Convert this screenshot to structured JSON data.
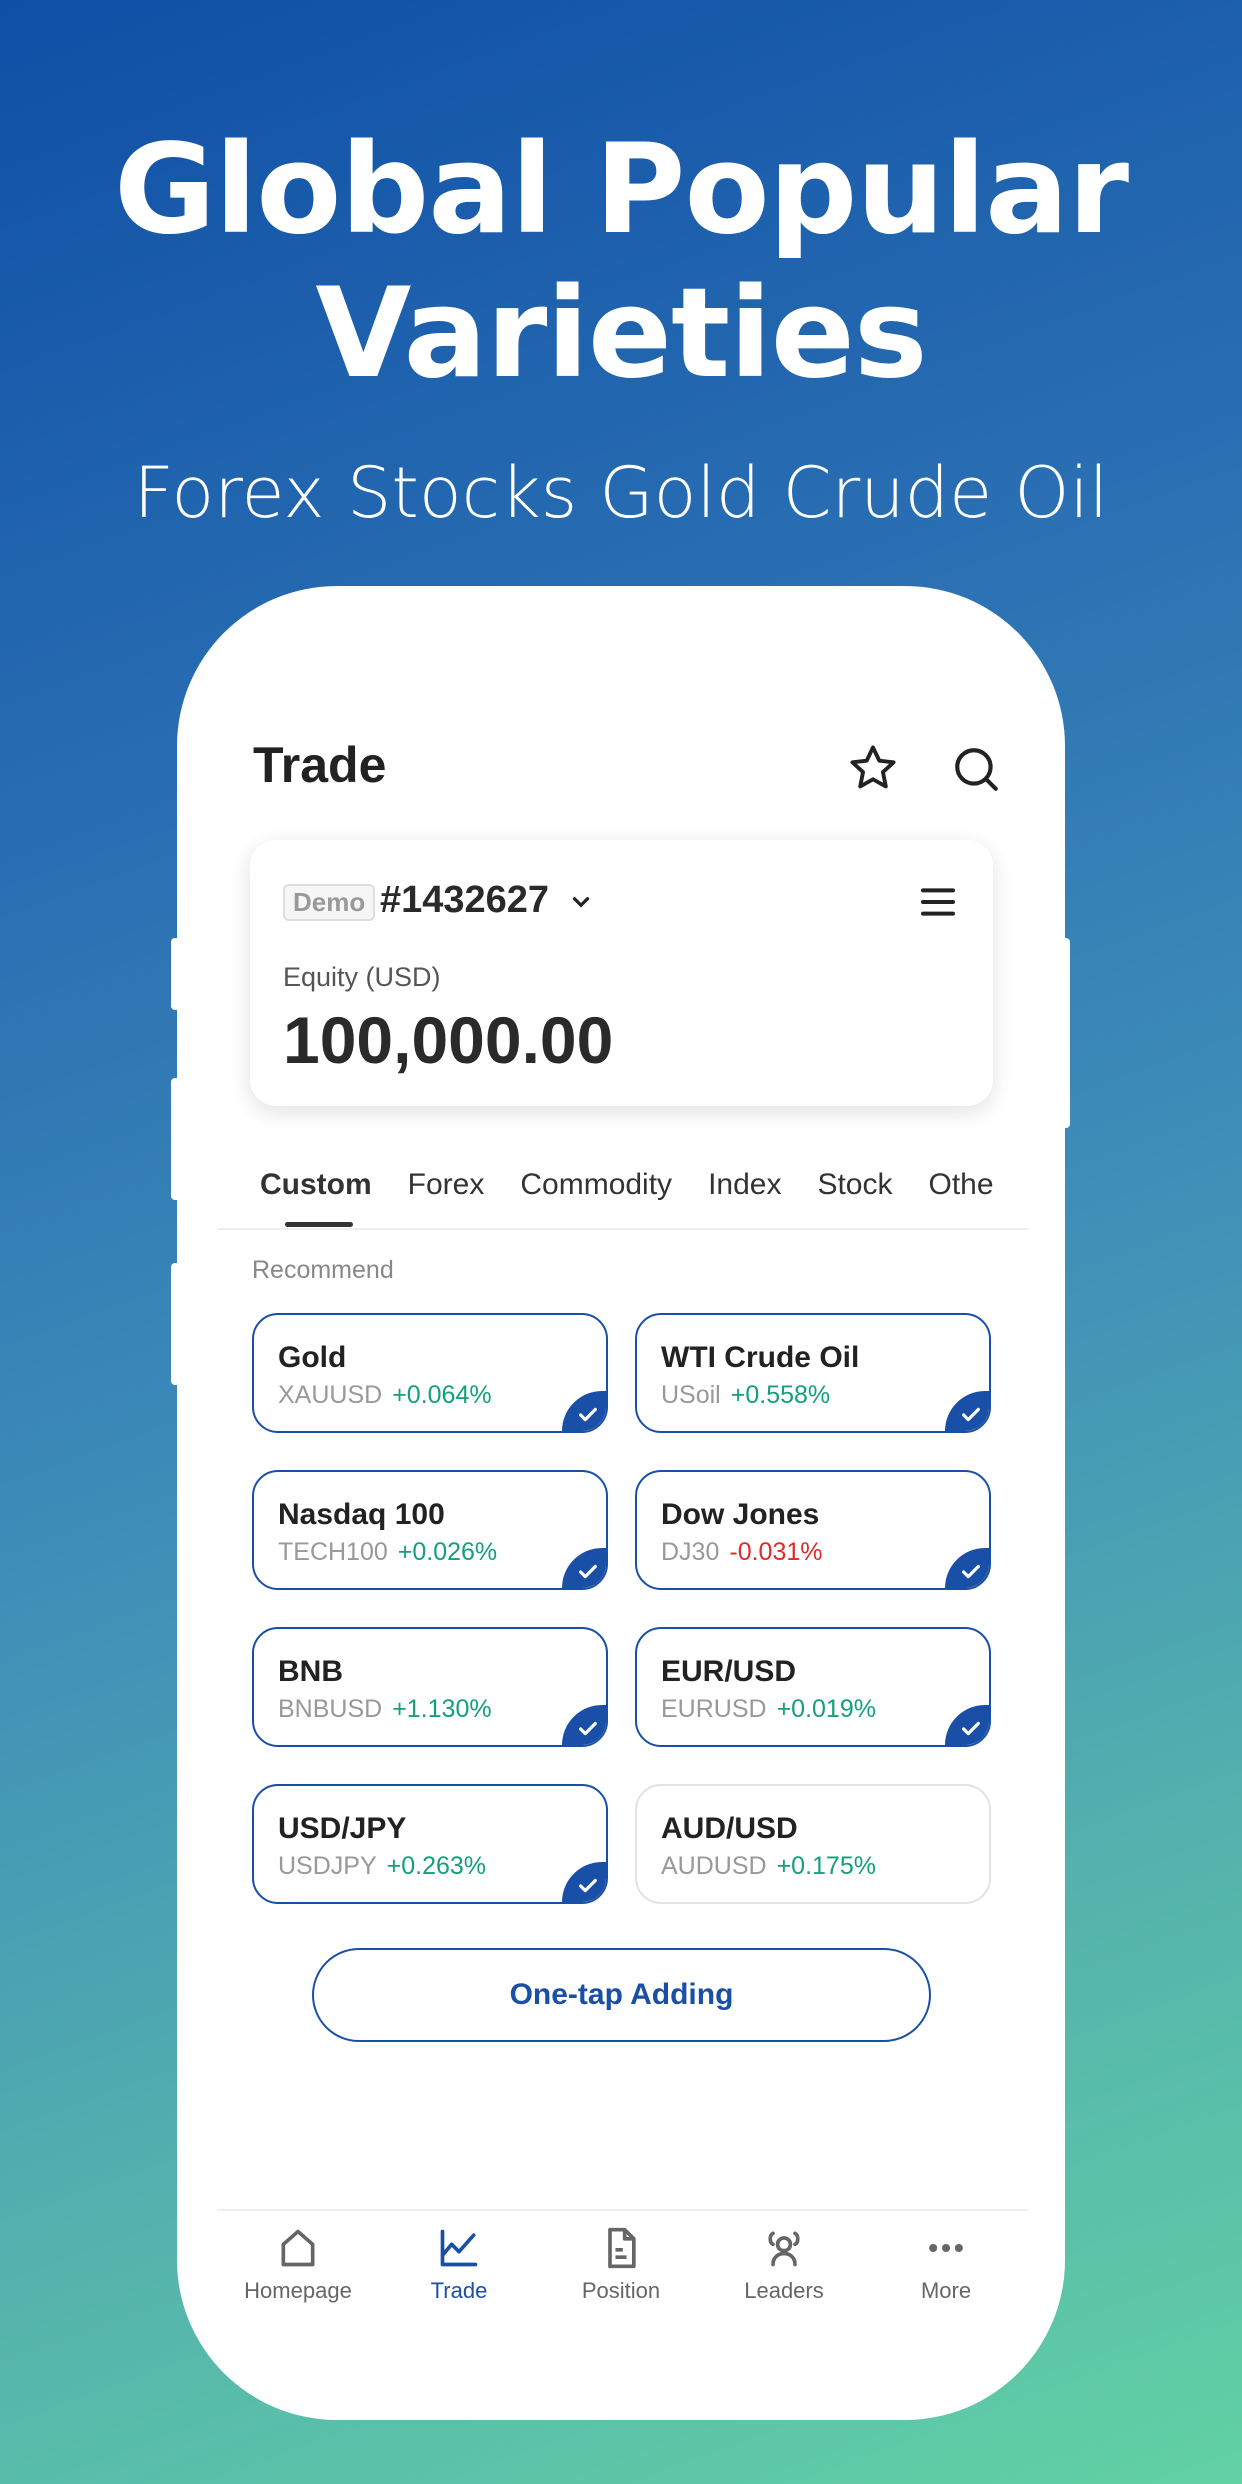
{
  "hero": {
    "title_line1": "Global Popular",
    "title_line2": "Varieties",
    "subtitle": "Forex Stocks Gold Crude Oil"
  },
  "header": {
    "title": "Trade",
    "icons": [
      "star-icon",
      "search-icon"
    ]
  },
  "account": {
    "badge": "Demo",
    "number": "#1432627",
    "equity_label": "Equity (USD)",
    "equity": "100,000.00"
  },
  "tabs": [
    "Custom",
    "Forex",
    "Commodity",
    "Index",
    "Stock",
    "Othe"
  ],
  "active_tab": "Custom",
  "section_label": "Recommend",
  "items": [
    {
      "name": "Gold",
      "symbol": "XAUUSD",
      "change": "+0.064%",
      "selected": true,
      "dir": "up"
    },
    {
      "name": "WTI Crude Oil",
      "symbol": "USoil",
      "change": "+0.558%",
      "selected": true,
      "dir": "up"
    },
    {
      "name": "Nasdaq 100",
      "symbol": "TECH100",
      "change": "+0.026%",
      "selected": true,
      "dir": "up"
    },
    {
      "name": "Dow Jones",
      "symbol": "DJ30",
      "change": "-0.031%",
      "selected": true,
      "dir": "down"
    },
    {
      "name": "BNB",
      "symbol": "BNBUSD",
      "change": "+1.130%",
      "selected": true,
      "dir": "up"
    },
    {
      "name": "EUR/USD",
      "symbol": "EURUSD",
      "change": "+0.019%",
      "selected": true,
      "dir": "up"
    },
    {
      "name": "USD/JPY",
      "symbol": "USDJPY",
      "change": "+0.263%",
      "selected": true,
      "dir": "up"
    },
    {
      "name": "AUD/USD",
      "symbol": "AUDUSD",
      "change": "+0.175%",
      "selected": false,
      "dir": "up"
    }
  ],
  "add_button": "One-tap Adding",
  "nav": [
    {
      "label": "Homepage",
      "icon": "home-icon"
    },
    {
      "label": "Trade",
      "icon": "chart-icon",
      "active": true
    },
    {
      "label": "Position",
      "icon": "document-icon"
    },
    {
      "label": "Leaders",
      "icon": "users-icon"
    },
    {
      "label": "More",
      "icon": "more-icon"
    }
  ],
  "colors": {
    "accent": "#1a4fa8",
    "up": "#14a07a",
    "down": "#e02b2b"
  }
}
